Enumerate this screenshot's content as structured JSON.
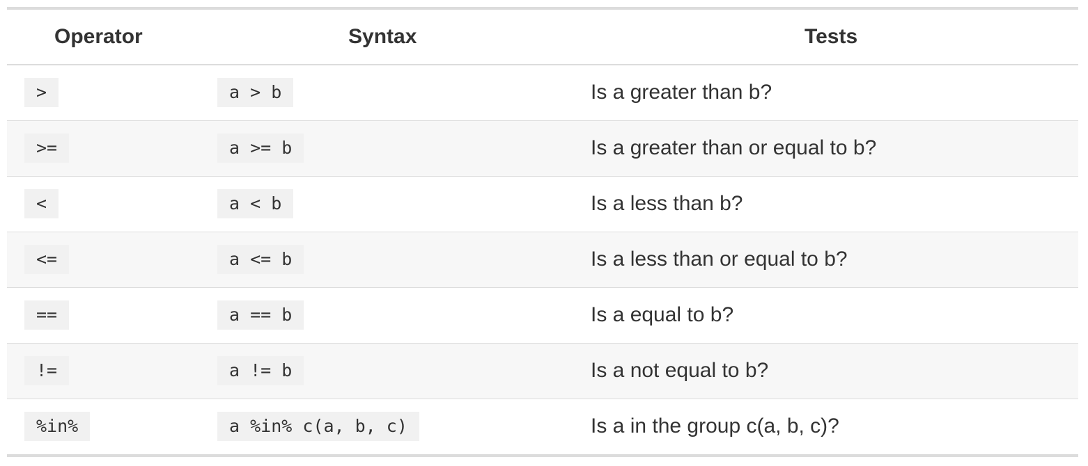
{
  "table": {
    "headers": {
      "operator": "Operator",
      "syntax": "Syntax",
      "tests": "Tests"
    },
    "rows": [
      {
        "operator": ">",
        "syntax": "a > b",
        "tests": "Is a greater than b?"
      },
      {
        "operator": ">=",
        "syntax": "a >= b",
        "tests": "Is a greater than or equal to b?"
      },
      {
        "operator": "<",
        "syntax": "a < b",
        "tests": "Is a less than b?"
      },
      {
        "operator": "<=",
        "syntax": "a <= b",
        "tests": "Is a less than or equal to b?"
      },
      {
        "operator": "==",
        "syntax": "a == b",
        "tests": "Is a equal to b?"
      },
      {
        "operator": "!=",
        "syntax": "a != b",
        "tests": "Is a not equal to b?"
      },
      {
        "operator": "%in%",
        "syntax": "a %in% c(a, b, c)",
        "tests": "Is a in the group c(a, b, c)?"
      }
    ]
  }
}
